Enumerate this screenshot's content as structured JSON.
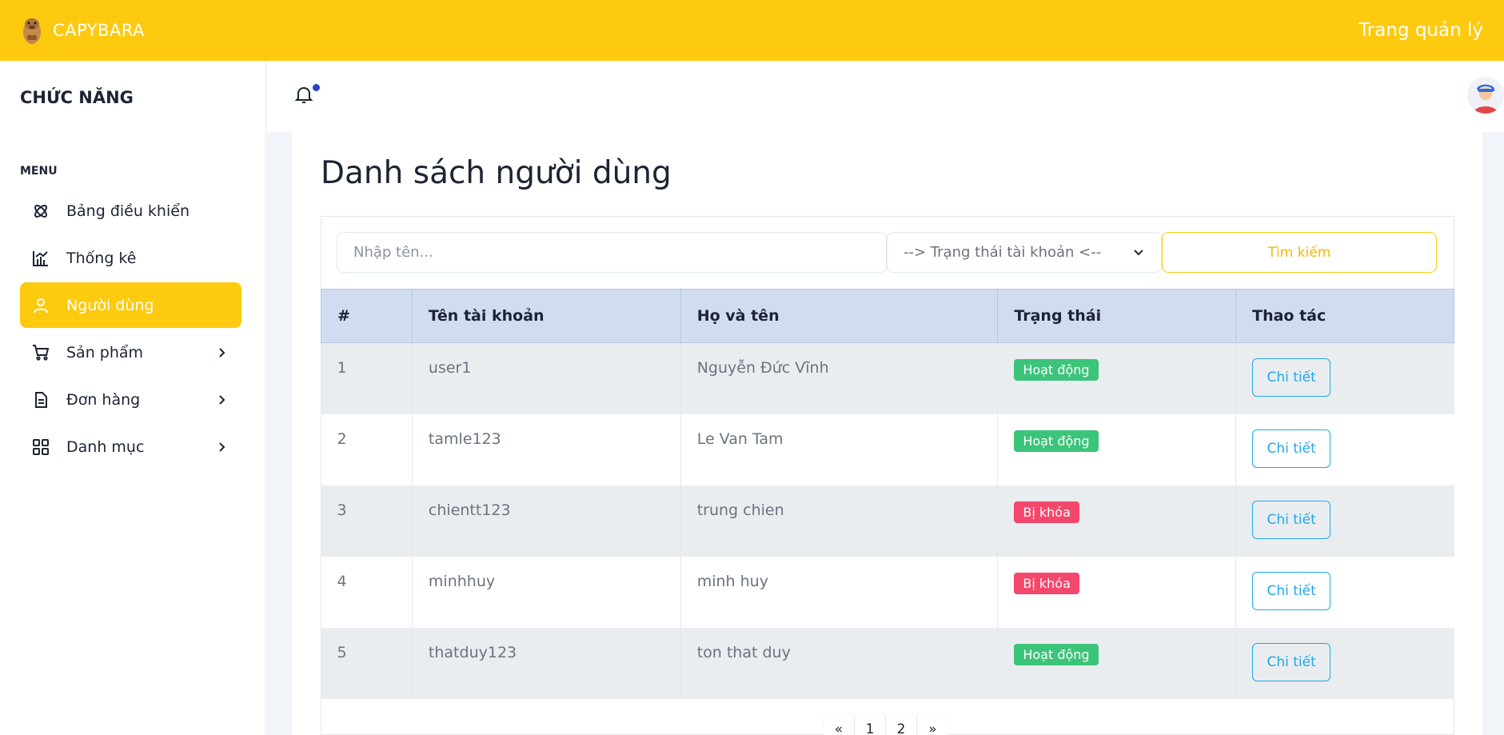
{
  "topbar": {
    "brand": "CAPYBARA",
    "admin_link": "Trang quản lý"
  },
  "sidebar": {
    "title": "CHỨC NĂNG",
    "menu_label": "MENU",
    "items": [
      {
        "label": "Bảng điều khiển",
        "icon": "dashboard-icon",
        "has_submenu": false
      },
      {
        "label": "Thống kê",
        "icon": "chart-icon",
        "has_submenu": false
      },
      {
        "label": "Người dùng",
        "icon": "user-icon",
        "has_submenu": false,
        "active": true
      },
      {
        "label": "Sản phẩm",
        "icon": "cart-icon",
        "has_submenu": true
      },
      {
        "label": "Đơn hàng",
        "icon": "document-icon",
        "has_submenu": true
      },
      {
        "label": "Danh mục",
        "icon": "grid-icon",
        "has_submenu": true
      }
    ]
  },
  "main": {
    "page_title": "Danh sách người dùng",
    "search": {
      "placeholder": "Nhập tên...",
      "status_select": "--> Trạng thái tài khoản <--",
      "button": "Tìm kiếm"
    },
    "table": {
      "headers": [
        "#",
        "Tên tài khoản",
        "Họ và tên",
        "Trạng thái",
        "Thao tác"
      ],
      "rows": [
        {
          "index": "1",
          "username": "user1",
          "fullname": "Nguyễn Đức Vĩnh",
          "status": "Hoạt động",
          "status_type": "active",
          "action": "Chi tiết"
        },
        {
          "index": "2",
          "username": "tamle123",
          "fullname": "Le Van Tam",
          "status": "Hoạt động",
          "status_type": "active",
          "action": "Chi tiết"
        },
        {
          "index": "3",
          "username": "chientt123",
          "fullname": "trung chien",
          "status": "Bị khóa",
          "status_type": "locked",
          "action": "Chi tiết"
        },
        {
          "index": "4",
          "username": "minhhuy",
          "fullname": "minh huy",
          "status": "Bị khóa",
          "status_type": "locked",
          "action": "Chi tiết"
        },
        {
          "index": "5",
          "username": "thatduy123",
          "fullname": "ton that duy",
          "status": "Hoạt động",
          "status_type": "active",
          "action": "Chi tiết"
        }
      ]
    },
    "pagination": [
      "«",
      "1",
      "2",
      "»"
    ]
  },
  "colors": {
    "accent": "#fdca0f",
    "active_badge": "#3bc47a",
    "locked_badge": "#f4476c",
    "detail_button": "#1fa8ea",
    "table_header": "#d1dcf1",
    "notification_dot": "#2744c9"
  }
}
